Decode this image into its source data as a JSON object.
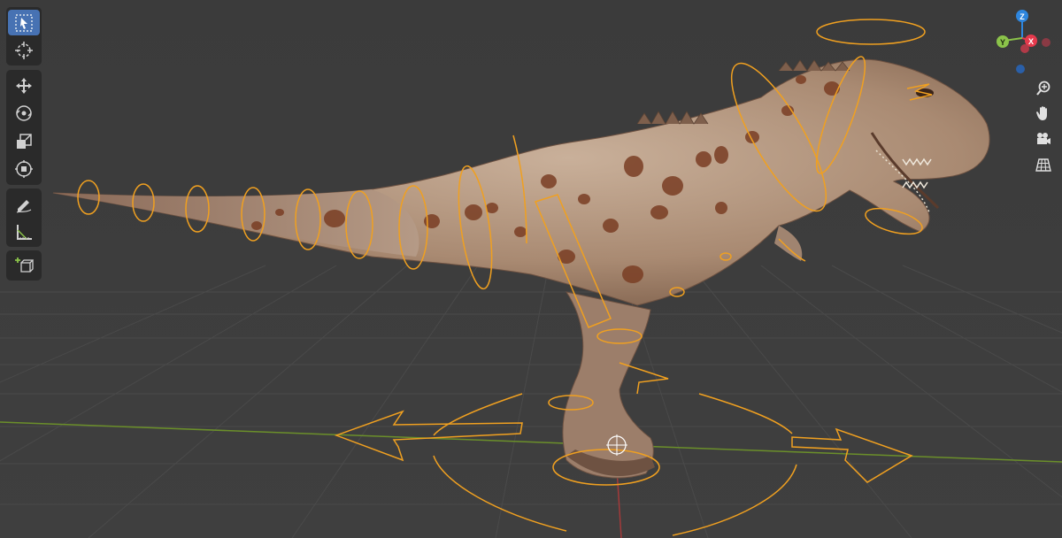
{
  "app": {
    "name": "3D Viewport"
  },
  "toolbar": {
    "tools": [
      {
        "id": "select",
        "icon": "select-box-icon",
        "active": true
      },
      {
        "id": "cursor",
        "icon": "cursor-crosshair-icon",
        "active": false
      },
      {
        "id": "move",
        "icon": "move-arrows-icon",
        "active": false
      },
      {
        "id": "rotate",
        "icon": "rotate-icon",
        "active": false
      },
      {
        "id": "scale",
        "icon": "scale-icon",
        "active": false
      },
      {
        "id": "transform",
        "icon": "transform-icon",
        "active": false
      },
      {
        "id": "annotate",
        "icon": "annotate-pencil-icon",
        "active": false
      },
      {
        "id": "measure",
        "icon": "measure-ruler-icon",
        "active": false
      },
      {
        "id": "add-cube",
        "icon": "add-cube-icon",
        "active": false
      }
    ]
  },
  "gizmo": {
    "axes": [
      {
        "label": "Z",
        "color": "#2e86de"
      },
      {
        "label": "Y",
        "color": "#8bc34a"
      },
      {
        "label": "X",
        "color": "#e5394c"
      }
    ]
  },
  "nav": {
    "buttons": [
      {
        "id": "zoom",
        "icon": "zoom-magnifier-icon"
      },
      {
        "id": "pan",
        "icon": "hand-pan-icon"
      },
      {
        "id": "camera",
        "icon": "camera-icon"
      },
      {
        "id": "ortho",
        "icon": "grid-perspective-icon"
      }
    ]
  },
  "colors": {
    "background": "#3c3c3c",
    "grid": "#474747",
    "rig_outline": "#f0a020",
    "active_tool": "#4772b3",
    "axis_x": "#e5394c",
    "axis_y": "#8bc34a",
    "axis_z": "#2e86de"
  },
  "scene": {
    "subject": "t-rex-model",
    "rig": "bone-controls"
  }
}
